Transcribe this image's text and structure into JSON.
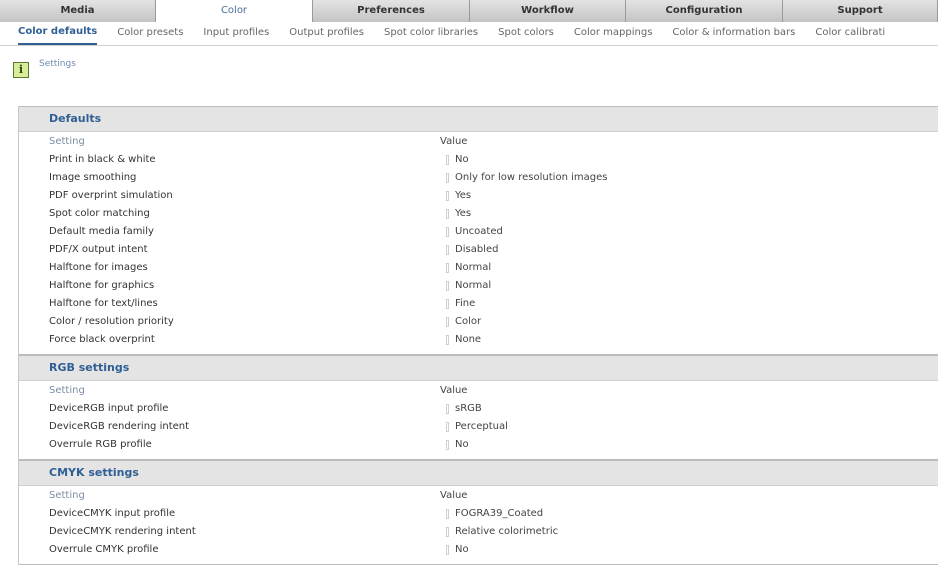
{
  "top_tabs": [
    {
      "label": "Media",
      "active": false,
      "w": 156
    },
    {
      "label": "Color",
      "active": true,
      "w": 157
    },
    {
      "label": "Preferences",
      "active": false,
      "w": 157
    },
    {
      "label": "Workflow",
      "active": false,
      "w": 156
    },
    {
      "label": "Configuration",
      "active": false,
      "w": 157
    },
    {
      "label": "Support",
      "active": false,
      "w": 155
    }
  ],
  "sub_tabs": [
    {
      "label": "Color defaults",
      "active": true
    },
    {
      "label": "Color presets",
      "active": false
    },
    {
      "label": "Input profiles",
      "active": false
    },
    {
      "label": "Output profiles",
      "active": false
    },
    {
      "label": "Spot color libraries",
      "active": false
    },
    {
      "label": "Spot colors",
      "active": false
    },
    {
      "label": "Color mappings",
      "active": false
    },
    {
      "label": "Color & information bars",
      "active": false
    },
    {
      "label": "Color calibrati",
      "active": false
    }
  ],
  "settings_link": {
    "icon": "info-icon",
    "label": "Settings"
  },
  "sections": [
    {
      "title": "Defaults",
      "header_setting": "Setting",
      "header_value": "Value",
      "rows": [
        {
          "setting": "Print in black & white",
          "value": "No"
        },
        {
          "setting": "Image smoothing",
          "value": "Only for low resolution images"
        },
        {
          "setting": "PDF overprint simulation",
          "value": "Yes"
        },
        {
          "setting": "Spot color matching",
          "value": "Yes"
        },
        {
          "setting": "Default media family",
          "value": "Uncoated"
        },
        {
          "setting": "PDF/X output intent",
          "value": "Disabled"
        },
        {
          "setting": "Halftone for images",
          "value": "Normal"
        },
        {
          "setting": "Halftone for graphics",
          "value": "Normal"
        },
        {
          "setting": "Halftone for text/lines",
          "value": "Fine"
        },
        {
          "setting": "Color / resolution priority",
          "value": "Color"
        },
        {
          "setting": "Force black overprint",
          "value": "None"
        }
      ]
    },
    {
      "title": "RGB settings",
      "header_setting": "Setting",
      "header_value": "Value",
      "rows": [
        {
          "setting": "DeviceRGB input profile",
          "value": "sRGB"
        },
        {
          "setting": "DeviceRGB rendering intent",
          "value": "Perceptual"
        },
        {
          "setting": "Overrule RGB profile",
          "value": "No"
        }
      ]
    },
    {
      "title": "CMYK settings",
      "header_setting": "Setting",
      "header_value": "Value",
      "rows": [
        {
          "setting": "DeviceCMYK input profile",
          "value": "FOGRA39_Coated"
        },
        {
          "setting": "DeviceCMYK rendering intent",
          "value": "Relative colorimetric"
        },
        {
          "setting": "Overrule CMYK profile",
          "value": "No"
        }
      ]
    }
  ]
}
